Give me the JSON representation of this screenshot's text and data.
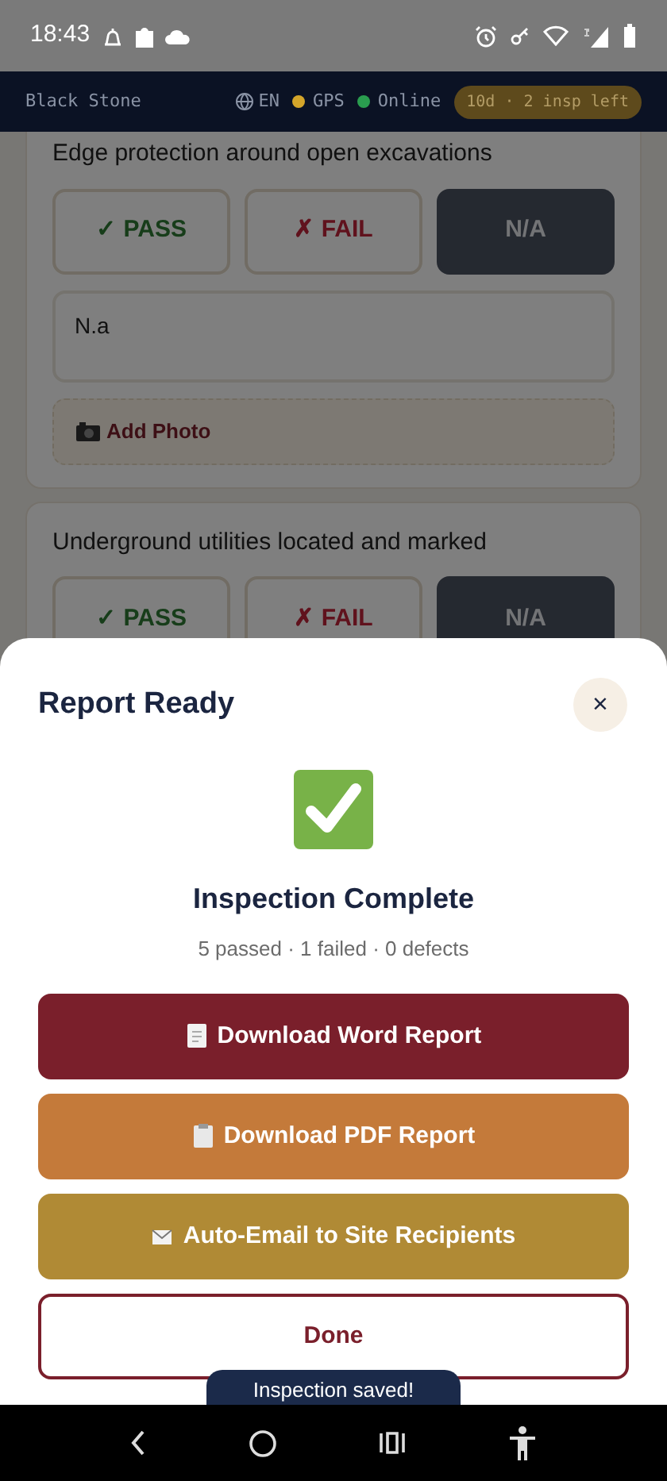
{
  "status_bar": {
    "time": "18:43"
  },
  "header": {
    "site": "Black Stone",
    "language": "EN",
    "indicators": [
      {
        "label": "GPS",
        "color": "#d4a52a"
      },
      {
        "label": "Online",
        "color": "#2a9d4f"
      }
    ],
    "badge": "10d · 2 insp left"
  },
  "checklist": [
    {
      "question": "Edge protection around open excavations",
      "options": [
        {
          "label": "✓ PASS",
          "kind": "pass",
          "selected": false
        },
        {
          "label": "✗ FAIL",
          "kind": "fail",
          "selected": false
        },
        {
          "label": "N/A",
          "kind": "na",
          "selected": true
        }
      ],
      "notes": "N.a",
      "photo_button": "Add Photo"
    },
    {
      "question": "Underground utilities located and marked",
      "options": [
        {
          "label": "✓ PASS",
          "kind": "pass",
          "selected": false
        },
        {
          "label": "✗ FAIL",
          "kind": "fail",
          "selected": false
        },
        {
          "label": "N/A",
          "kind": "na",
          "selected": true
        }
      ]
    }
  ],
  "dialog": {
    "title": "Report Ready",
    "close": "×",
    "heading": "Inspection Complete",
    "summary": "5 passed · 1 failed · 0 defects",
    "actions": [
      {
        "label": "Download Word Report",
        "kind": "word"
      },
      {
        "label": "Download PDF Report",
        "kind": "pdf"
      },
      {
        "label": "Auto-Email to Site Recipients",
        "kind": "email"
      },
      {
        "label": "Done",
        "kind": "done"
      }
    ]
  },
  "toast": "Inspection saved!"
}
